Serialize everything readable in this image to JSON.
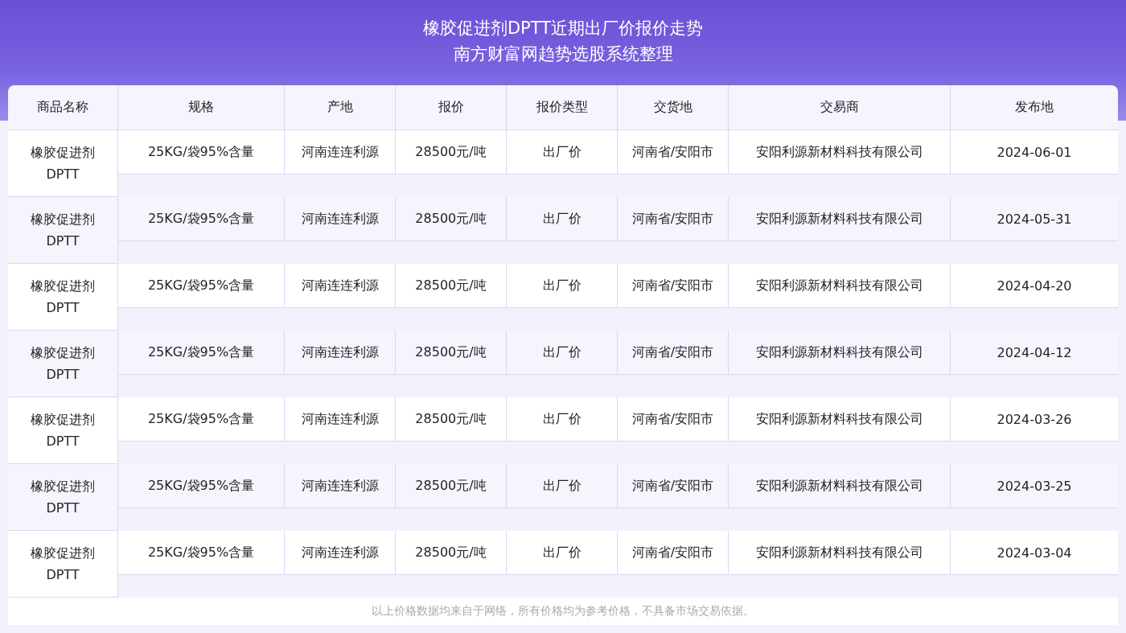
{
  "header": {
    "title_lines": [
      "橡胶促进剂DPTT近期出厂价报价走势",
      "南方财富网趋势选股系统整理"
    ]
  },
  "table": {
    "columns": [
      "商品名称",
      "规格",
      "产地",
      "报价",
      "报价类型",
      "交货地",
      "交易商",
      "发布地"
    ],
    "rows": [
      {
        "cells": [
          "橡胶促进剂DPTT",
          "25KG/袋95%含量",
          "河南连连利源",
          "28500元/吨",
          "出厂价",
          "河南省/安阳市",
          "安阳利源新材料科技有限公司",
          "2024-06-01"
        ]
      },
      {
        "cells": [
          "橡胶促进剂DPTT",
          "25KG/袋95%含量",
          "河南连连利源",
          "28500元/吨",
          "出厂价",
          "河南省/安阳市",
          "安阳利源新材料科技有限公司",
          "2024-05-31"
        ]
      },
      {
        "cells": [
          "橡胶促进剂DPTT",
          "25KG/袋95%含量",
          "河南连连利源",
          "28500元/吨",
          "出厂价",
          "河南省/安阳市",
          "安阳利源新材料科技有限公司",
          "2024-04-20"
        ]
      },
      {
        "cells": [
          "橡胶促进剂DPTT",
          "25KG/袋95%含量",
          "河南连连利源",
          "28500元/吨",
          "出厂价",
          "河南省/安阳市",
          "安阳利源新材料科技有限公司",
          "2024-04-12"
        ]
      },
      {
        "cells": [
          "橡胶促进剂DPTT",
          "25KG/袋95%含量",
          "河南连连利源",
          "28500元/吨",
          "出厂价",
          "河南省/安阳市",
          "安阳利源新材料科技有限公司",
          "2024-03-26"
        ]
      },
      {
        "cells": [
          "橡胶促进剂DPTT",
          "25KG/袋95%含量",
          "河南连连利源",
          "28500元/吨",
          "出厂价",
          "河南省/安阳市",
          "安阳利源新材料科技有限公司",
          "2024-03-25"
        ]
      },
      {
        "cells": [
          "橡胶促进剂DPTT",
          "25KG/袋95%含量",
          "河南连连利源",
          "28500元/吨",
          "出厂价",
          "河南省/安阳市",
          "安阳利源新材料科技有限公司",
          "2024-03-04"
        ]
      }
    ]
  },
  "footer": {
    "note": "以上价格数据均来自于网络，所有价格均为参考价格，不具备市场交易依据。"
  }
}
